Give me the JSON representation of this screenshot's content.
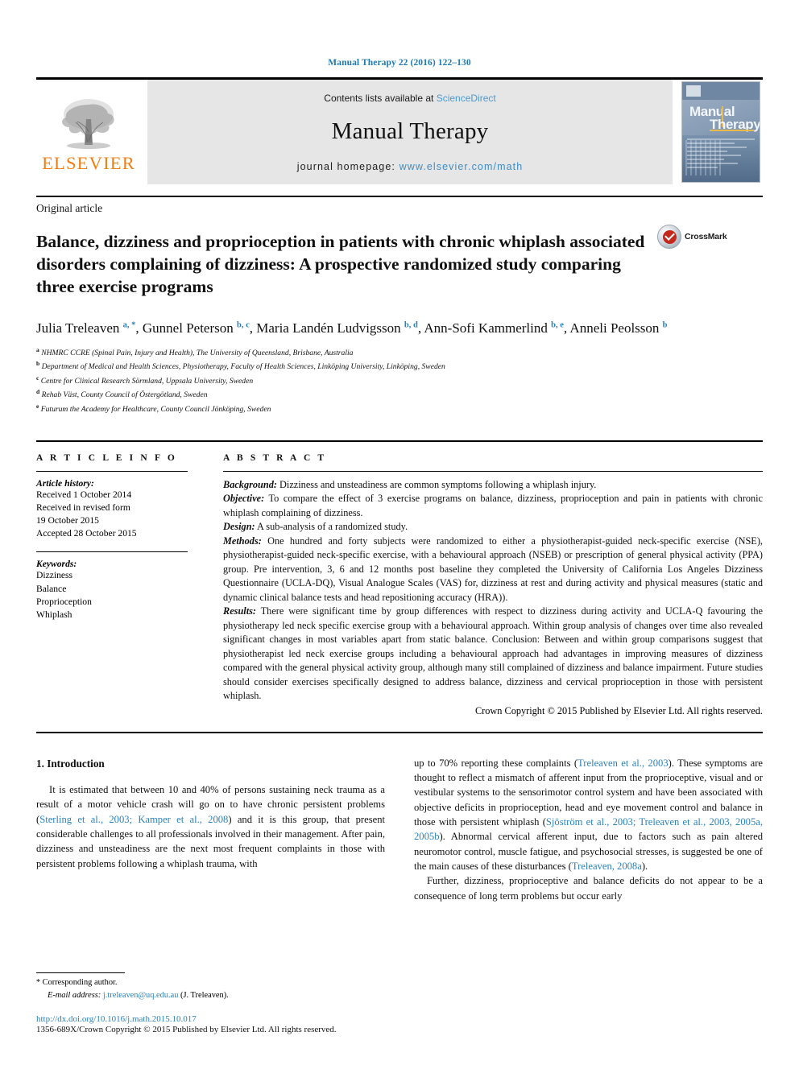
{
  "running_head": "Manual Therapy 22 (2016) 122–130",
  "masthead": {
    "publisher": "ELSEVIER",
    "contents_prefix": "Contents lists available at ",
    "contents_link": "ScienceDirect",
    "journal_name": "Manual Therapy",
    "homepage_prefix": "journal homepage: ",
    "homepage_url": "www.elsevier.com/math",
    "cover_title_line1": "Manual",
    "cover_title_line2": "Therapy"
  },
  "article": {
    "type": "Original article",
    "title": "Balance, dizziness and proprioception in patients with chronic whiplash associated disorders complaining of dizziness: A prospective randomized study comparing three exercise programs",
    "crossmark_label": "CrossMark",
    "authors": [
      {
        "name": "Julia Treleaven",
        "sup": "a, *"
      },
      {
        "name": "Gunnel Peterson",
        "sup": "b, c"
      },
      {
        "name": "Maria Landén Ludvigsson",
        "sup": "b, d"
      },
      {
        "name": "Ann-Sofi Kammerlind",
        "sup": "b, e"
      },
      {
        "name": "Anneli Peolsson",
        "sup": "b"
      }
    ],
    "affiliations": [
      {
        "mark": "a",
        "text": "NHMRC CCRE (Spinal Pain, Injury and Health), The University of Queensland, Brisbane, Australia"
      },
      {
        "mark": "b",
        "text": "Department of Medical and Health Sciences, Physiotherapy, Faculty of Health Sciences, Linköping University, Linköping, Sweden"
      },
      {
        "mark": "c",
        "text": "Centre for Clinical Research Sörmland, Uppsala University, Sweden"
      },
      {
        "mark": "d",
        "text": "Rehab Väst, County Council of Östergötland, Sweden"
      },
      {
        "mark": "e",
        "text": "Futurum the Academy for Healthcare, County Council Jönköping, Sweden"
      }
    ]
  },
  "article_info": {
    "heading": "A R T I C L E   I N F O",
    "history_label": "Article history:",
    "history_lines": [
      "Received 1 October 2014",
      "Received in revised form",
      "19 October 2015",
      "Accepted 28 October 2015"
    ],
    "keywords_label": "Keywords:",
    "keywords": [
      "Dizziness",
      "Balance",
      "Proprioception",
      "Whiplash"
    ]
  },
  "abstract": {
    "heading": "A B S T R A C T",
    "sections": [
      {
        "label": "Background:",
        "text": " Dizziness and unsteadiness are common symptoms following a whiplash injury."
      },
      {
        "label": "Objective:",
        "text": " To compare the effect of 3 exercise programs on balance, dizziness, proprioception and pain in patients with chronic whiplash complaining of dizziness."
      },
      {
        "label": "Design:",
        "text": " A sub-analysis of a randomized study."
      },
      {
        "label": "Methods:",
        "text": " One hundred and forty subjects were randomized to either a physiotherapist-guided neck-specific exercise (NSE), physiotherapist-guided neck-specific exercise, with a behavioural approach (NSEB) or prescription of general physical activity (PPA) group. Pre intervention, 3, 6 and 12 months post baseline they completed the University of California Los Angeles Dizziness Questionnaire (UCLA-DQ), Visual Analogue Scales (VAS) for, dizziness at rest and during activity and physical measures (static and dynamic clinical balance tests and head repositioning accuracy (HRA))."
      },
      {
        "label": "Results:",
        "text": " There were significant time by group differences with respect to dizziness during activity and UCLA-Q favouring the physiotherapy led neck specific exercise group with a behavioural approach. Within group analysis of changes over time also revealed significant changes in most variables apart from static balance. Conclusion: Between and within group comparisons suggest that physiotherapist led neck exercise groups including a behavioural approach had advantages in improving measures of dizziness compared with the general physical activity group, although many still complained of dizziness and balance impairment. Future studies should consider exercises specifically designed to address balance, dizziness and cervical proprioception in those with persistent whiplash."
      }
    ],
    "copyright": "Crown Copyright © 2015 Published by Elsevier Ltd. All rights reserved."
  },
  "body": {
    "section_number_title": "1. Introduction",
    "col1_para1_a": "It is estimated that between 10 and 40% of persons sustaining neck trauma as a result of a motor vehicle crash will go on to have chronic persistent problems (",
    "col1_ref1": "Sterling et al., 2003; Kamper et al., 2008",
    "col1_para1_b": ") and it is this group, that present considerable challenges to all professionals involved in their management. After pain, dizziness and unsteadiness are the next most frequent complaints in those with persistent problems following a whiplash trauma, with",
    "col2_para1_a": "up to 70% reporting these complaints (",
    "col2_ref1": "Treleaven et al., 2003",
    "col2_para1_b": "). These symptoms are thought to reflect a mismatch of afferent input from the proprioceptive, visual and or vestibular systems to the sensorimotor control system and have been associated with objective deficits in proprioception, head and eye movement control and balance in those with persistent whiplash (",
    "col2_ref2": "Sjöström et al., 2003; Treleaven et al., 2003, 2005a, 2005b",
    "col2_para1_c": "). Abnormal cervical afferent input, due to factors such as pain altered neuromotor control, muscle fatigue, and psychosocial stresses, is suggested be one of the main causes of these disturbances (",
    "col2_ref3": "Treleaven, 2008a",
    "col2_para1_d": ").",
    "col2_para2": "Further, dizziness, proprioceptive and balance deficits do not appear to be a consequence of long term problems but occur early"
  },
  "footnote": {
    "corresponding_marker": "*",
    "corresponding_text": " Corresponding author.",
    "email_label": "E-mail address:",
    "email": "j.treleaven@uq.edu.au",
    "email_owner": " (J. Treleaven).",
    "doi": "http://dx.doi.org/10.1016/j.math.2015.10.017",
    "issn_line": "1356-689X/Crown Copyright © 2015 Published by Elsevier Ltd. All rights reserved."
  },
  "colors": {
    "link": "#2a82bd",
    "elsevier_orange": "#f07f13",
    "running_head": "#1f7ab0"
  }
}
